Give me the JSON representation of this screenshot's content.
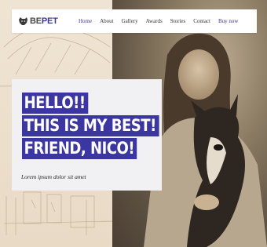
{
  "brand": {
    "part1": "BE",
    "part2": "PET"
  },
  "nav": {
    "items": [
      {
        "label": "Home",
        "active": true
      },
      {
        "label": "About",
        "active": false
      },
      {
        "label": "Gallery",
        "active": false
      },
      {
        "label": "Awards",
        "active": false
      },
      {
        "label": "Stories",
        "active": false
      },
      {
        "label": "Contact",
        "active": false
      }
    ],
    "cta": "Buy now"
  },
  "hero": {
    "headline": [
      "HELLO!!",
      "THIS IS MY BEST!",
      "FRIEND, NICO!"
    ],
    "subtitle": "Lorem ipsum dolor sit amet"
  },
  "colors": {
    "accent": "#3c36a0",
    "card_bg": "#f1f0f2",
    "bg": "#e9dccb"
  }
}
